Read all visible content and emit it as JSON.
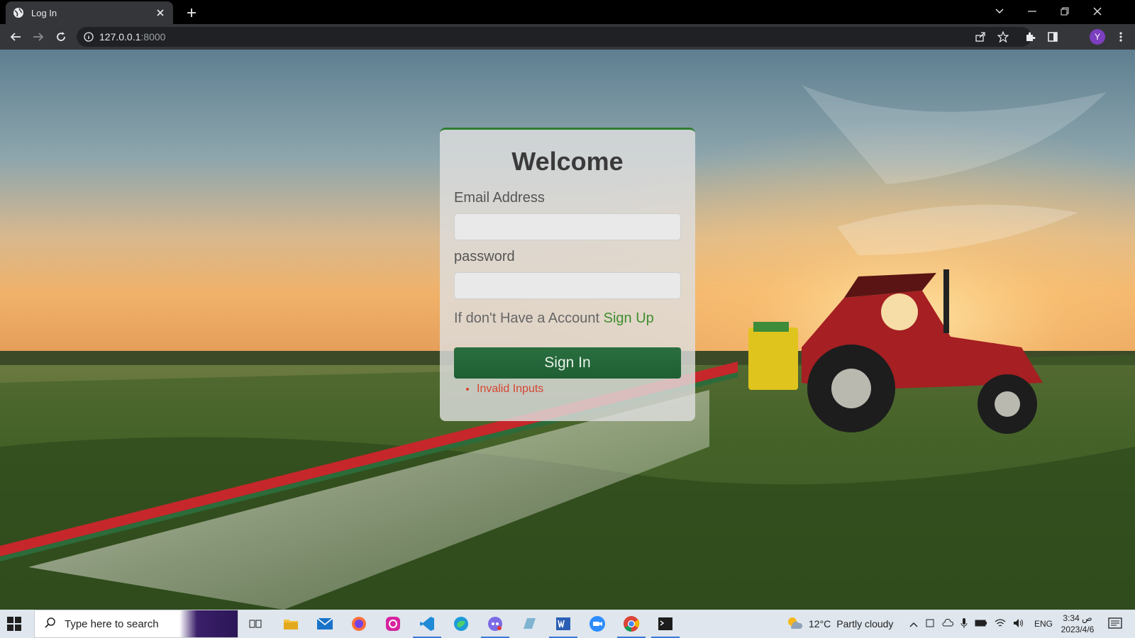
{
  "browser": {
    "tab_title": "Log In",
    "url_host": "127.0.0.1",
    "url_port": ":8000",
    "profile_initial": "Y"
  },
  "login": {
    "heading": "Welcome",
    "email_label": "Email Address",
    "password_label": "password",
    "signup_prompt": "If don't Have a Account ",
    "signup_link": "Sign Up",
    "submit_label": "Sign In",
    "errors": [
      "Invalid Inputs"
    ]
  },
  "taskbar": {
    "search_placeholder": "Type here to search",
    "weather_temp": "12°C",
    "weather_desc": "Partly cloudy",
    "language": "ENG",
    "time": "3:34 ص",
    "date": "2023/4/6"
  },
  "colors": {
    "accent_green": "#2a6e3f",
    "link_green": "#3f8d2f",
    "error_red": "#d64532"
  }
}
